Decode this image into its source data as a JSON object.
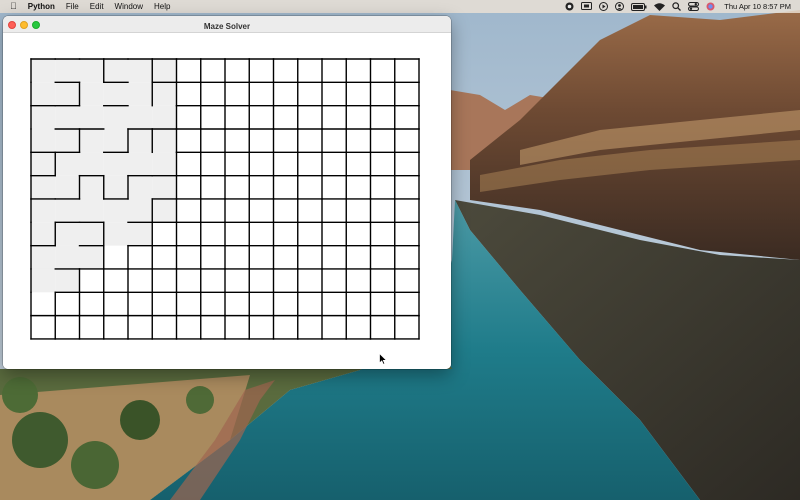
{
  "menubar": {
    "apple_icon": "apple-logo-icon",
    "app_name": "Python",
    "menus": [
      "File",
      "Edit",
      "Window",
      "Help"
    ],
    "status_icons": [
      "record-icon",
      "screen-mirror-icon",
      "play-icon",
      "user-icon",
      "battery-icon",
      "wifi-icon",
      "search-icon",
      "control-center-icon",
      "siri-icon"
    ],
    "clock": "Thu Apr 10  8:57 PM"
  },
  "window": {
    "title": "Maze Solver",
    "buttons": [
      "close",
      "minimize",
      "zoom"
    ]
  },
  "maze": {
    "rows": 12,
    "cols": 16,
    "line_color": "#000000",
    "visited_color": "#efefef",
    "visited_cells": [
      [
        0,
        0
      ],
      [
        0,
        1
      ],
      [
        0,
        2
      ],
      [
        0,
        3
      ],
      [
        0,
        4
      ],
      [
        0,
        5
      ],
      [
        1,
        0
      ],
      [
        1,
        1
      ],
      [
        1,
        2
      ],
      [
        1,
        3
      ],
      [
        1,
        4
      ],
      [
        1,
        5
      ],
      [
        2,
        0
      ],
      [
        2,
        1
      ],
      [
        2,
        2
      ],
      [
        2,
        3
      ],
      [
        2,
        4
      ],
      [
        2,
        5
      ],
      [
        3,
        0
      ],
      [
        3,
        1
      ],
      [
        3,
        2
      ],
      [
        3,
        3
      ],
      [
        3,
        4
      ],
      [
        3,
        5
      ],
      [
        4,
        0
      ],
      [
        4,
        1
      ],
      [
        4,
        2
      ],
      [
        4,
        3
      ],
      [
        4,
        4
      ],
      [
        4,
        5
      ],
      [
        5,
        0
      ],
      [
        5,
        1
      ],
      [
        5,
        2
      ],
      [
        5,
        3
      ],
      [
        5,
        4
      ],
      [
        5,
        5
      ],
      [
        6,
        0
      ],
      [
        6,
        1
      ],
      [
        6,
        2
      ],
      [
        6,
        3
      ],
      [
        6,
        4
      ],
      [
        6,
        5
      ],
      [
        7,
        0
      ],
      [
        7,
        1
      ],
      [
        7,
        2
      ],
      [
        7,
        3
      ],
      [
        7,
        4
      ],
      [
        8,
        0
      ],
      [
        8,
        1
      ],
      [
        8,
        2
      ],
      [
        9,
        0
      ],
      [
        9,
        1
      ]
    ],
    "open_walls": [
      [
        "h",
        0,
        0
      ],
      [
        "h",
        0,
        2
      ],
      [
        "h",
        0,
        4
      ],
      [
        "v",
        0,
        1
      ],
      [
        "v",
        0,
        2
      ],
      [
        "v",
        0,
        4
      ],
      [
        "h",
        1,
        2
      ],
      [
        "h",
        1,
        4
      ],
      [
        "h",
        1,
        5
      ],
      [
        "v",
        1,
        1
      ],
      [
        "v",
        1,
        3
      ],
      [
        "v",
        1,
        4
      ],
      [
        "v",
        2,
        1
      ],
      [
        "v",
        2,
        2
      ],
      [
        "v",
        2,
        3
      ],
      [
        "v",
        2,
        4
      ],
      [
        "v",
        2,
        5
      ],
      [
        "h",
        2,
        0
      ],
      [
        "h",
        2,
        3
      ],
      [
        "v",
        3,
        1
      ],
      [
        "v",
        3,
        3
      ],
      [
        "h",
        3,
        2
      ],
      [
        "h",
        3,
        4
      ],
      [
        "h",
        3,
        5
      ],
      [
        "v",
        4,
        2
      ],
      [
        "v",
        4,
        3
      ],
      [
        "v",
        4,
        4
      ],
      [
        "v",
        4,
        5
      ],
      [
        "h",
        4,
        1
      ],
      [
        "h",
        4,
        3
      ],
      [
        "v",
        5,
        1
      ],
      [
        "v",
        5,
        5
      ],
      [
        "h",
        5,
        2
      ],
      [
        "h",
        5,
        4
      ],
      [
        "v",
        6,
        1
      ],
      [
        "v",
        6,
        2
      ],
      [
        "v",
        6,
        3
      ],
      [
        "v",
        6,
        4
      ],
      [
        "h",
        6,
        0
      ],
      [
        "h",
        6,
        3
      ],
      [
        "v",
        7,
        2
      ],
      [
        "v",
        7,
        4
      ],
      [
        "h",
        7,
        1
      ],
      [
        "h",
        7,
        3
      ],
      [
        "v",
        8,
        1
      ],
      [
        "v",
        8,
        2
      ],
      [
        "h",
        8,
        0
      ],
      [
        "v",
        9,
        1
      ],
      [
        "h",
        9,
        0
      ]
    ]
  }
}
